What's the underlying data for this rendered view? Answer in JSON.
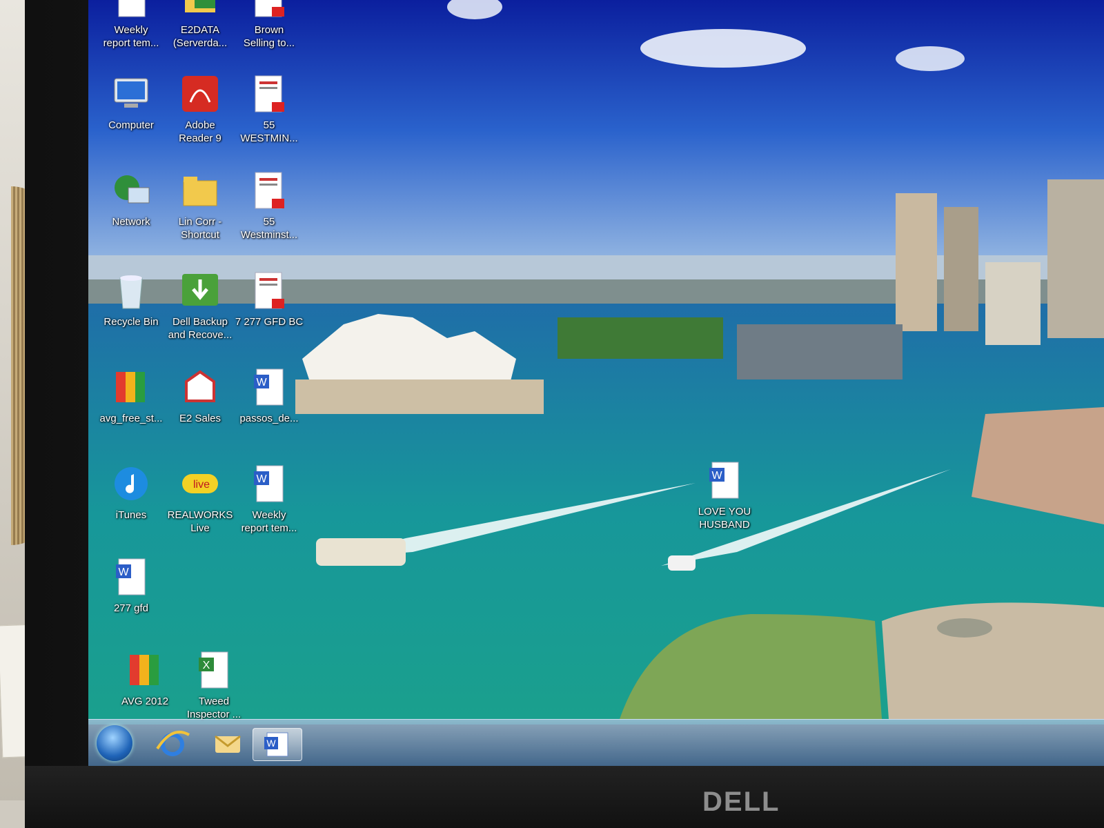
{
  "desktop": {
    "icons": [
      {
        "id": "weekly1",
        "label": "Weekly\nreport tem...",
        "icon": "word-doc-icon"
      },
      {
        "id": "e2data",
        "label": "E2DATA\n(Serverda...",
        "icon": "network-folder-icon"
      },
      {
        "id": "brown",
        "label": "Brown\nSelling to...",
        "icon": "pdf-doc-icon"
      },
      {
        "id": "computer",
        "label": "Computer",
        "icon": "computer-icon"
      },
      {
        "id": "adobe",
        "label": "Adobe\nReader 9",
        "icon": "adobe-reader-icon"
      },
      {
        "id": "w55a",
        "label": "55\nWESTMIN...",
        "icon": "pdf-doc-icon"
      },
      {
        "id": "network",
        "label": "Network",
        "icon": "network-globe-icon"
      },
      {
        "id": "lincorr",
        "label": "Lin Corr -\nShortcut",
        "icon": "folder-icon"
      },
      {
        "id": "w55b",
        "label": "55\nWestminst...",
        "icon": "pdf-doc-icon"
      },
      {
        "id": "recycle",
        "label": "Recycle Bin",
        "icon": "recycle-bin-icon"
      },
      {
        "id": "dellbackup",
        "label": "Dell Backup\nand Recove...",
        "icon": "backup-icon"
      },
      {
        "id": "gfdbc",
        "label": "7 277 GFD BC",
        "icon": "pdf-doc-icon"
      },
      {
        "id": "avgfree",
        "label": "avg_free_st...",
        "icon": "avg-icon"
      },
      {
        "id": "e2sales",
        "label": "E2 Sales",
        "icon": "e2-sales-icon"
      },
      {
        "id": "passos",
        "label": "passos_de...",
        "icon": "word-doc-icon"
      },
      {
        "id": "itunes",
        "label": "iTunes",
        "icon": "itunes-icon"
      },
      {
        "id": "realworks",
        "label": "REALWORKS\nLive",
        "icon": "realworks-live-icon"
      },
      {
        "id": "weekly2",
        "label": "Weekly\nreport tem...",
        "icon": "word-doc-icon"
      },
      {
        "id": "gfd277",
        "label": "277 gfd",
        "icon": "word-doc-icon"
      },
      {
        "id": "avg2012",
        "label": "AVG 2012",
        "icon": "avg-icon"
      },
      {
        "id": "tweed",
        "label": "Tweed\nInspector ...",
        "icon": "excel-doc-icon"
      },
      {
        "id": "loveyou",
        "label": "LOVE YOU\nHUSBAND",
        "icon": "word-doc-icon"
      }
    ]
  },
  "taskbar": {
    "items": [
      {
        "name": "start-button",
        "icon": "windows-orb-icon"
      },
      {
        "name": "internet-explorer",
        "icon": "internet-explorer-icon"
      },
      {
        "name": "outlook",
        "icon": "outlook-icon"
      },
      {
        "name": "word",
        "icon": "word-icon"
      }
    ]
  },
  "monitor": {
    "brand": "DELL"
  },
  "colors": {
    "sky_top": "#0e2aa8",
    "sky_mid": "#2f6fd0",
    "water": "#1a9a9c",
    "taskbar": "#5f8fbf"
  }
}
